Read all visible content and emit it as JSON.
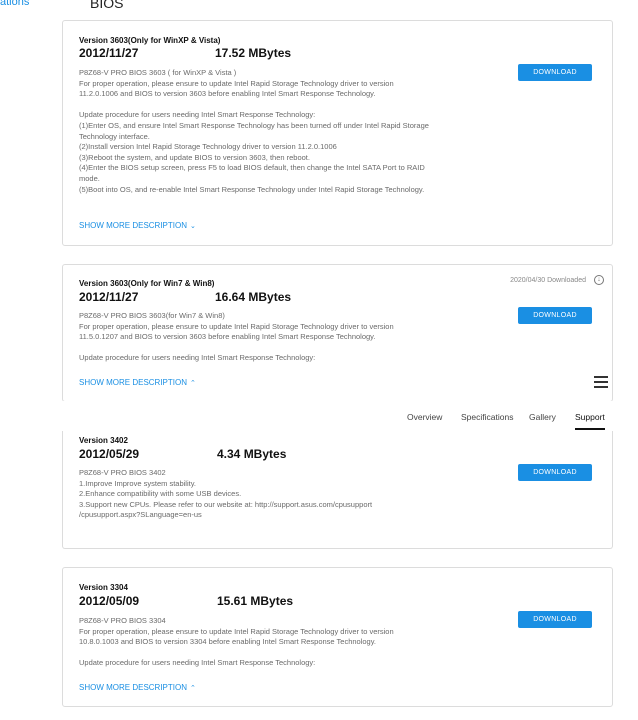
{
  "sidebar": {
    "partial_link": "ations"
  },
  "section": {
    "title": "BIOS"
  },
  "cards": [
    {
      "version": "Version 3603(Only for WinXP & Vista)",
      "date": "2012/11/27",
      "size": "17.52 MBytes",
      "button": "DOWNLOAD",
      "desc": [
        "P8Z68-V PRO BIOS 3603 ( for WinXP & Vista )",
        "For proper operation, please ensure to update Intel Rapid Storage Technology driver to version",
        "11.2.0.1006 and BIOS to version 3603 before enabling Intel Smart Response Technology.",
        "",
        "Update procedure for users needing Intel Smart Response Technology:",
        "(1)Enter OS, and ensure Intel Smart Response Technology has been turned off under Intel Rapid Storage",
        "Technology interface.",
        "(2)Install version Intel Rapid Storage Technology driver to version 11.2.0.1006",
        "(3)Reboot the system, and update BIOS to version 3603, then reboot.",
        "(4)Enter the BIOS setup screen, press F5 to load BIOS default, then change the Intel SATA Port to RAID",
        "mode.",
        "(5)Boot into OS, and re-enable Intel Smart Response Technology under Intel Rapid Storage Technology."
      ],
      "more": "SHOW MORE DESCRIPTION",
      "more_chev": "⌄"
    },
    {
      "version": "Version 3603(Only for Win7 & Win8)",
      "date": "2012/11/27",
      "size": "16.64 MBytes",
      "button": "DOWNLOAD",
      "downloaded": "2020/04/30 Downloaded",
      "desc": [
        "P8Z68-V PRO BIOS 3603(for Win7 & Win8)",
        "For proper operation, please ensure to update Intel Rapid Storage Technology driver to version",
        "11.5.0.1207 and BIOS to version 3603 before enabling Intel Smart Response Technology.",
        "",
        "Update procedure for users needing Intel Smart Response Technology:"
      ],
      "more": "SHOW MORE DESCRIPTION",
      "more_chev": "⌃"
    },
    {
      "version": "Version 3402",
      "date": "2012/05/29",
      "size": "4.34 MBytes",
      "button": "DOWNLOAD",
      "desc": [
        "P8Z68-V PRO BIOS 3402",
        "1.Improve Improve system stability.",
        "2.Enhance compatibility with some USB devices.",
        "3.Support new CPUs. Please refer to our website at: http://support.asus.com/cpusupport",
        "/cpusupport.aspx?SLanguage=en-us"
      ]
    },
    {
      "version": "Version 3304",
      "date": "2012/05/09",
      "size": "15.61 MBytes",
      "button": "DOWNLOAD",
      "desc": [
        "P8Z68-V PRO BIOS 3304",
        "For proper operation, please ensure to update Intel Rapid Storage Technology driver to version",
        "10.8.0.1003 and BIOS to version 3304 before enabling Intel Smart Response Technology.",
        "",
        "Update procedure for users needing Intel Smart Response Technology:"
      ],
      "more": "SHOW MORE DESCRIPTION",
      "more_chev": "⌃"
    }
  ],
  "nav": {
    "tabs": [
      "Overview",
      "Specifications",
      "Gallery",
      "Support"
    ],
    "active": "Support"
  },
  "icons": {
    "menu": "hamburger-menu-icon",
    "download_status": "download-circle-icon"
  },
  "colors": {
    "accent": "#1a8fe3",
    "text_muted": "#6a6a6a",
    "border": "#dcdcdc"
  }
}
